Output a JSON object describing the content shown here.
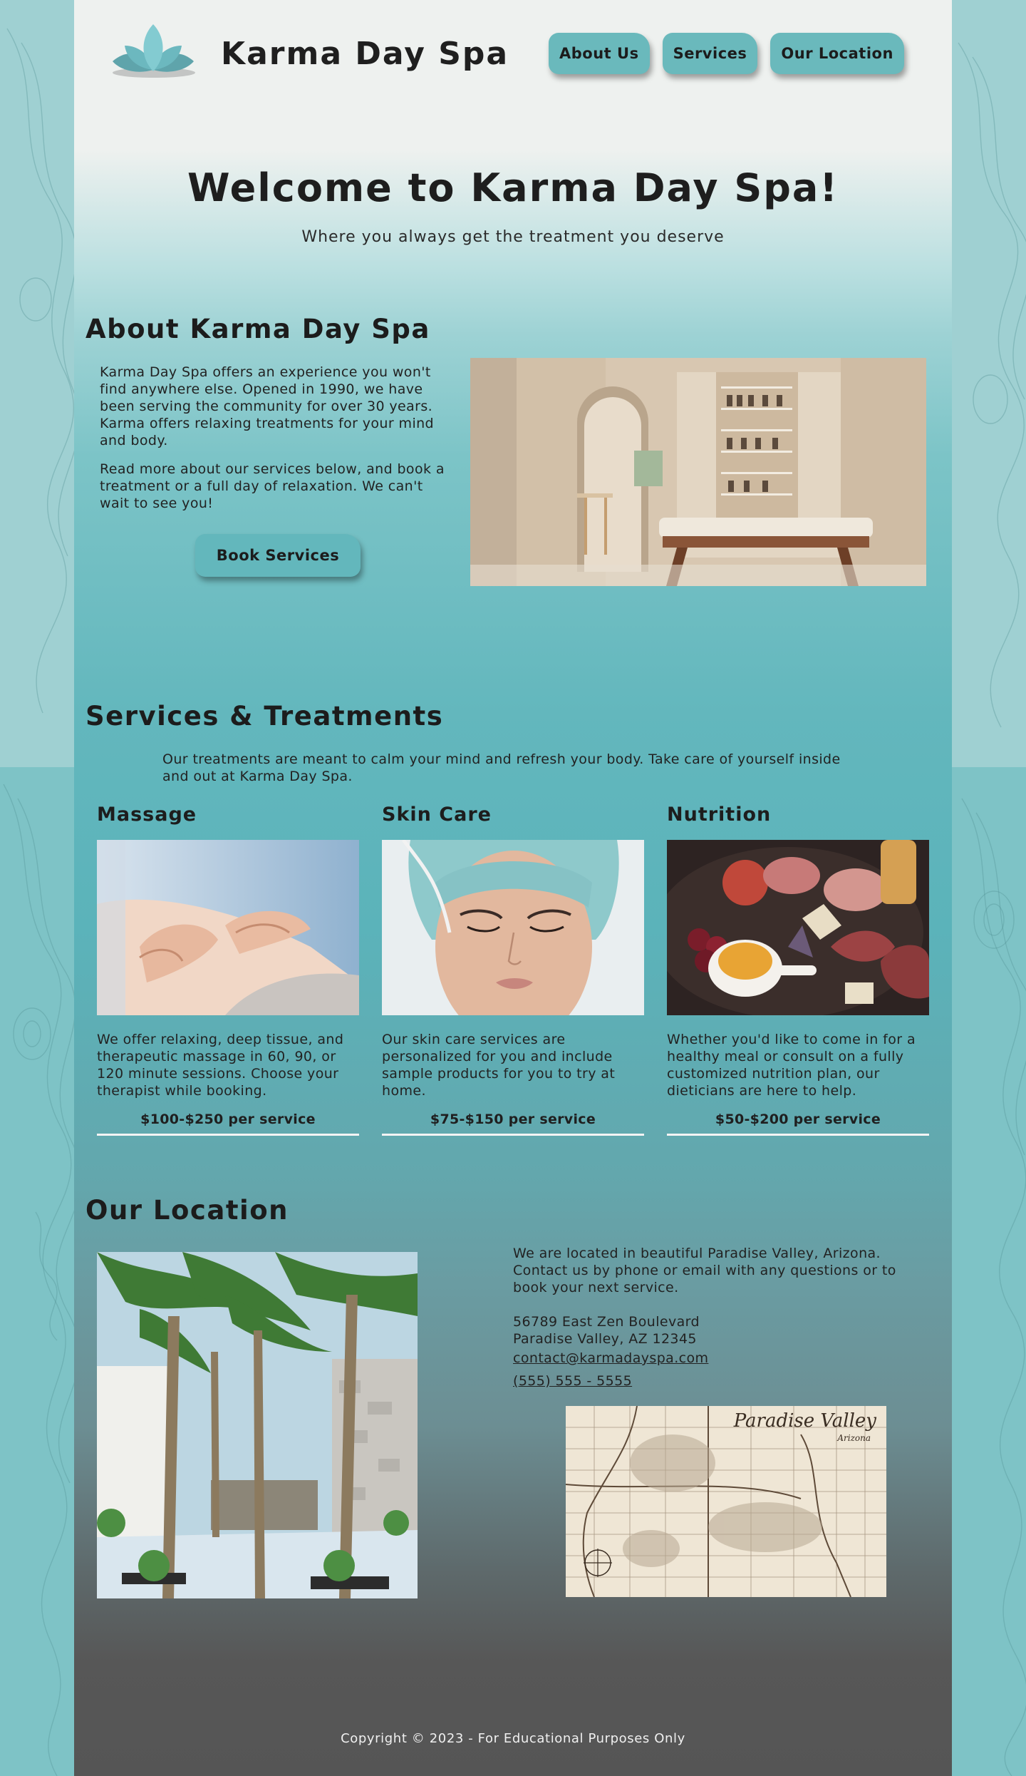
{
  "brand": {
    "name": "Karma Day Spa",
    "accent": "#6ab9bc",
    "text": "#1f1f1f"
  },
  "nav": {
    "items": [
      {
        "label": "About Us"
      },
      {
        "label": "Services"
      },
      {
        "label": "Our Location"
      }
    ]
  },
  "hero": {
    "title": "Welcome to Karma Day Spa!",
    "subtitle": "Where you always get the treatment you deserve"
  },
  "about": {
    "heading": "About Karma Day Spa",
    "paragraphs": [
      "Karma Day Spa offers an experience you won't find anywhere else. Opened in 1990, we have been serving the community for over 30 years. Karma offers relaxing treatments for your mind and body.",
      "Read more about our services below, and book a treatment or a full day of relaxation. We can't wait to see you!"
    ],
    "book_button": "Book Services",
    "image_icon": "treatment-room-photo"
  },
  "services": {
    "heading": "Services & Treatments",
    "intro": "Our treatments are meant to calm your mind and refresh your body. Take care of yourself inside and out at Karma Day Spa.",
    "items": [
      {
        "title": "Massage",
        "description": "We offer relaxing, deep tissue, and therapeutic massage in 60, 90, or 120 minute sessions. Choose your therapist while booking.",
        "price": "$100-$250 per service",
        "image_icon": "massage-photo"
      },
      {
        "title": "Skin Care",
        "description": "Our skin care services are personalized for you and include sample products for you to try at home.",
        "price": "$75-$150 per service",
        "image_icon": "skin-care-photo"
      },
      {
        "title": "Nutrition",
        "description": "Whether you'd like to come in for a healthy meal or consult on a fully customized nutrition plan, our dieticians are here to help.",
        "price": "$50-$200 per service",
        "image_icon": "charcuterie-photo"
      }
    ]
  },
  "location": {
    "heading": "Our Location",
    "intro": "We are located in beautiful Paradise Valley, Arizona. Contact us by phone or email with any questions or to book your next service.",
    "address_line1": "56789 East Zen Boulevard",
    "address_line2": "Paradise Valley, AZ 12345",
    "email": "contact@karmadayspa.com",
    "phone": "(555) 555 - 5555",
    "map_label": "Paradise Valley",
    "map_sublabel": "Arizona",
    "image_icon": "palm-courtyard-photo"
  },
  "footer": {
    "copyright": "Copyright © 2023 - For Educational Purposes Only"
  }
}
